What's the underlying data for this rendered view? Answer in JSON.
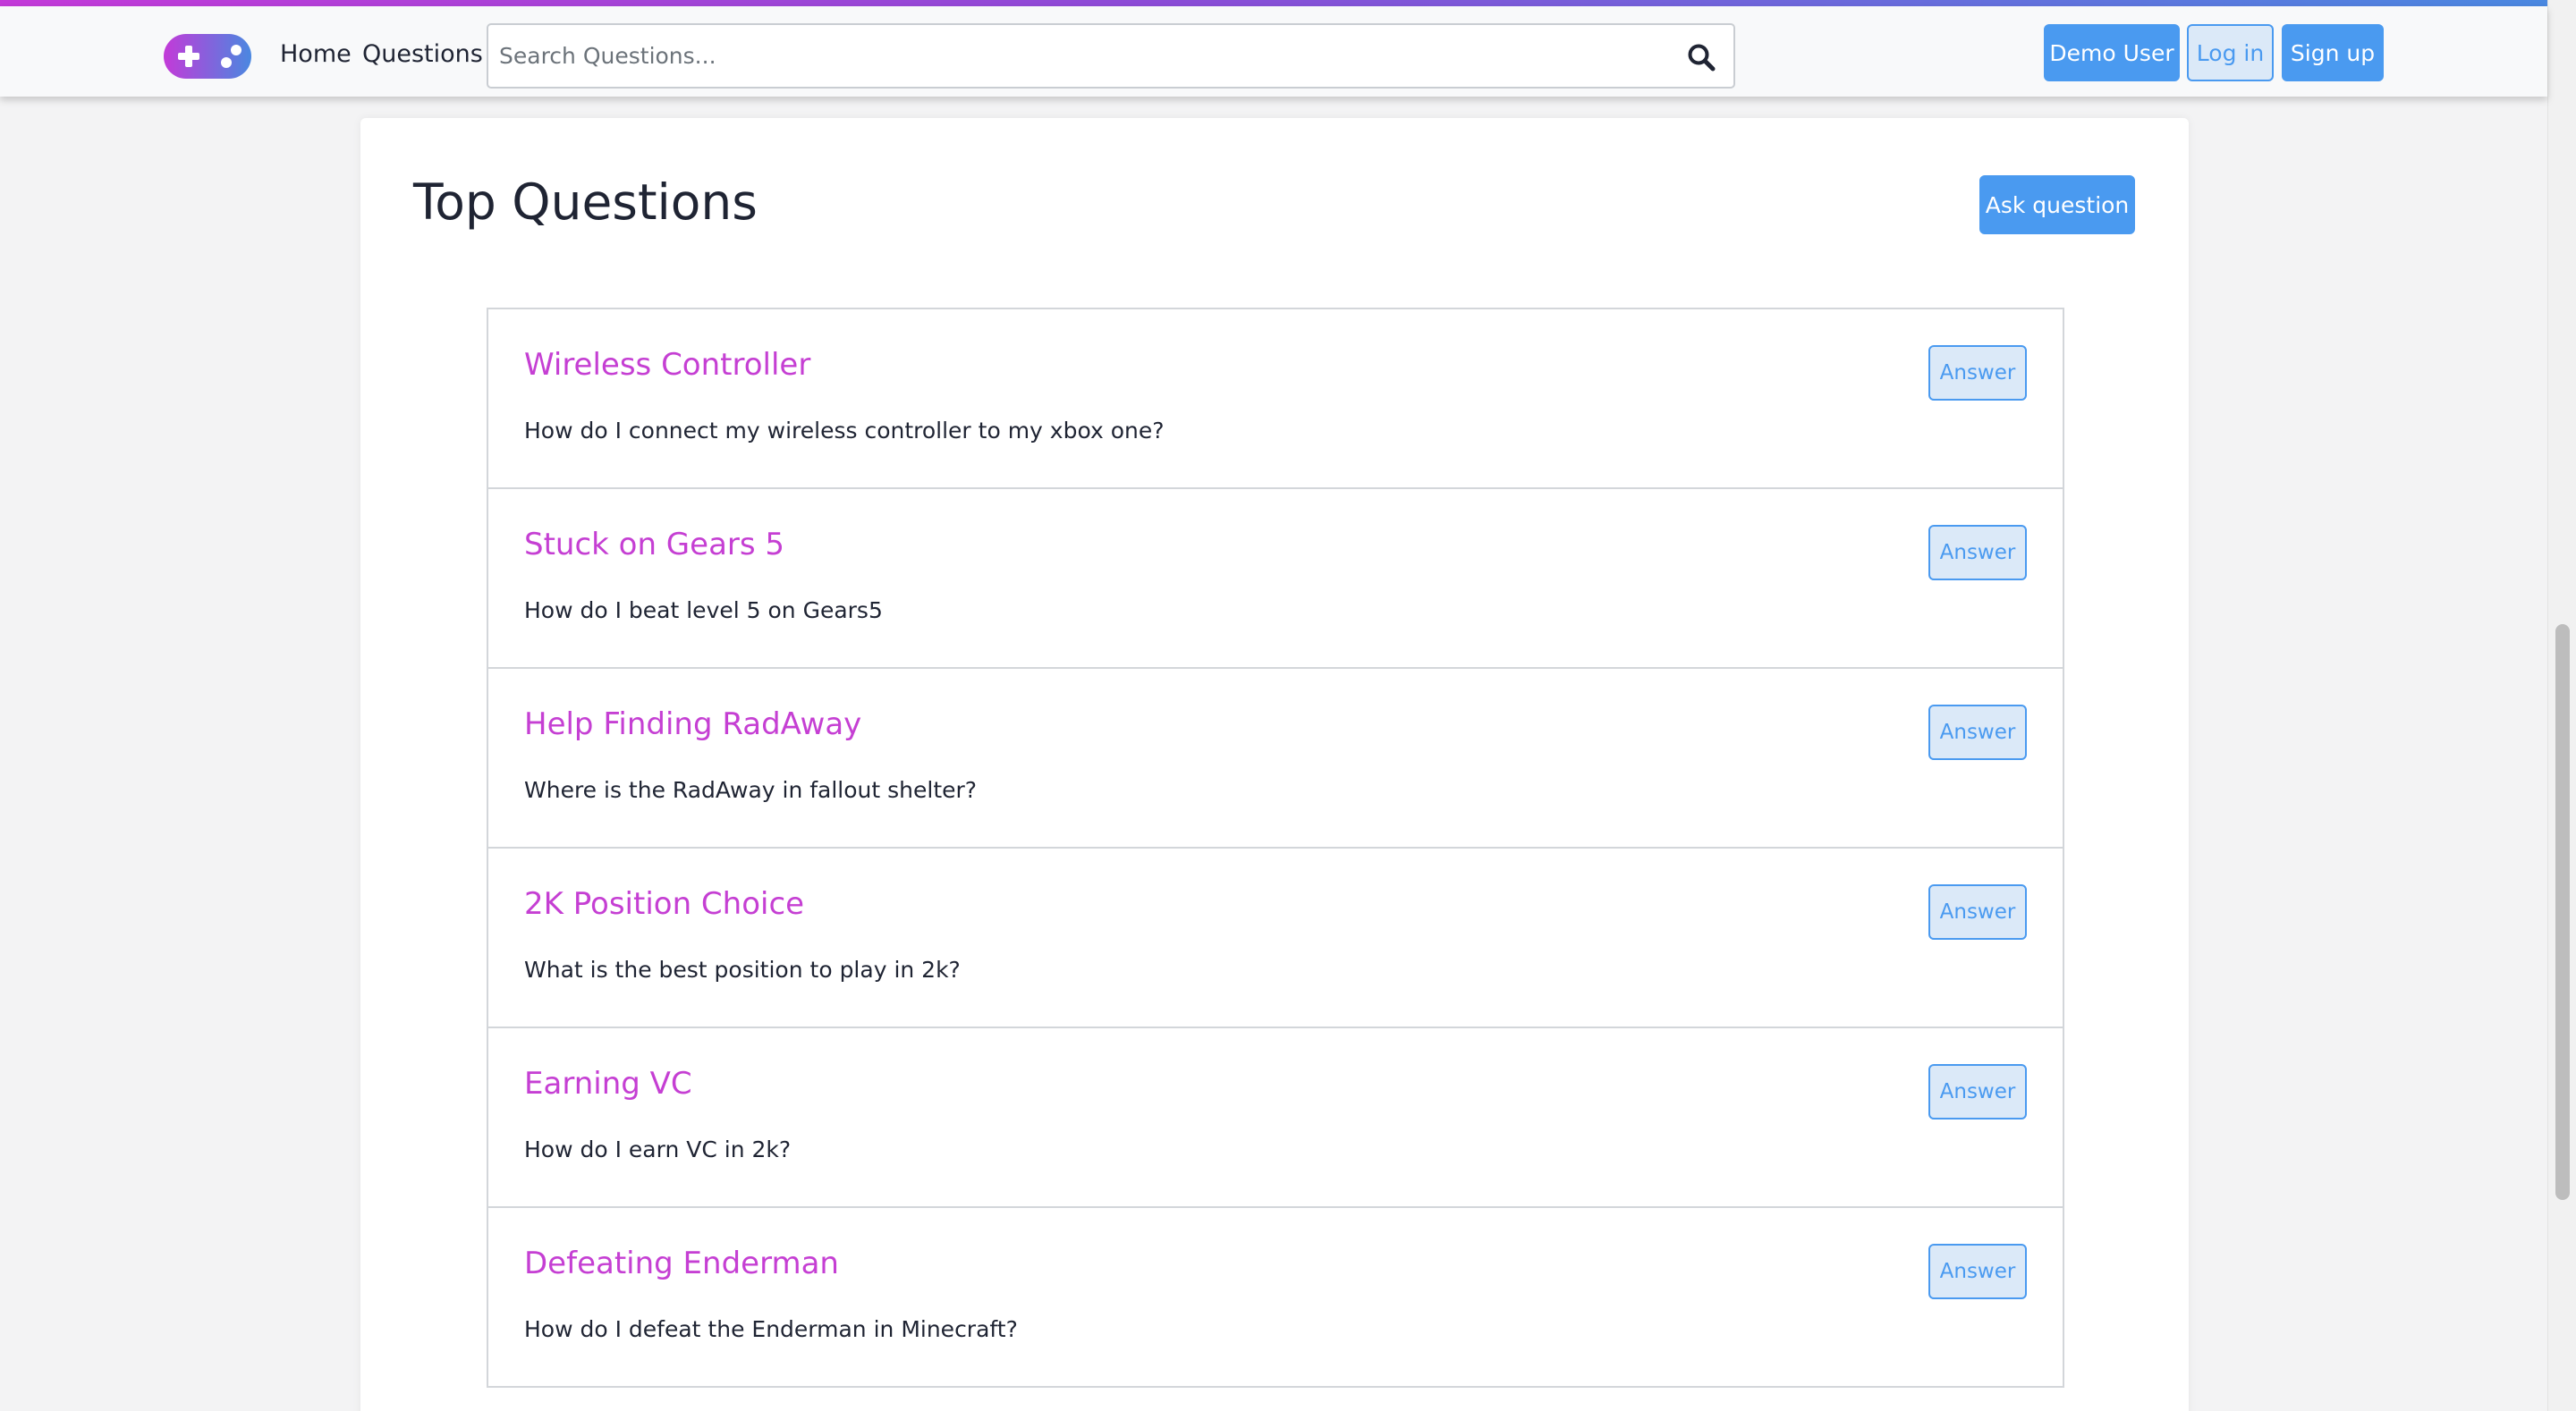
{
  "colors": {
    "accent": "#4a9af0",
    "title_link": "#c53fd3",
    "logo_gradient_start": "#c33ad8",
    "logo_gradient_end": "#4a88e0"
  },
  "navbar": {
    "logo_icon": "gamepad-icon",
    "links": {
      "home": "Home",
      "questions": "Questions"
    },
    "search": {
      "placeholder": "Search Questions...",
      "value": "",
      "icon": "search-icon"
    },
    "buttons": {
      "demo_user": "Demo User",
      "log_in": "Log in",
      "sign_up": "Sign up"
    }
  },
  "main": {
    "title": "Top Questions",
    "ask_button": "Ask question",
    "answer_label": "Answer",
    "questions": [
      {
        "title": "Wireless Controller",
        "body": "How do I connect my wireless controller to my xbox one?"
      },
      {
        "title": "Stuck on Gears 5",
        "body": "How do I beat level 5 on Gears5"
      },
      {
        "title": "Help Finding RadAway",
        "body": "Where is the RadAway in fallout shelter?"
      },
      {
        "title": "2K Position Choice",
        "body": "What is the best position to play in 2k?"
      },
      {
        "title": "Earning VC",
        "body": "How do I earn VC in 2k?"
      },
      {
        "title": "Defeating Enderman",
        "body": "How do I defeat the Enderman in Minecraft?"
      }
    ]
  }
}
